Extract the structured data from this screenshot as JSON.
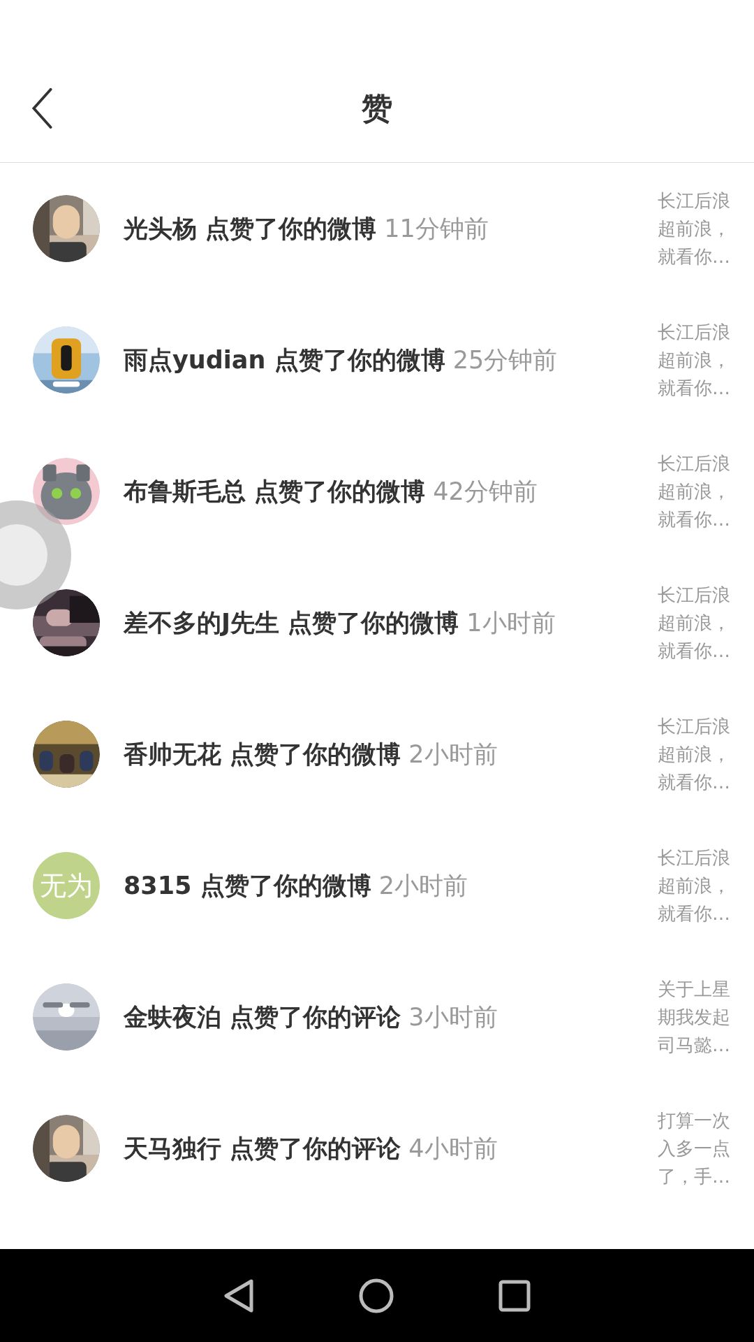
{
  "header": {
    "title": "赞"
  },
  "notifications": [
    {
      "name": "光头杨",
      "action": "点赞了你的微博",
      "time": "11分钟前",
      "preview": "长江后浪超前浪，就看你…"
    },
    {
      "name": "雨点yudian",
      "action": "点赞了你的微博",
      "time": "25分钟前",
      "preview": "长江后浪超前浪，就看你…"
    },
    {
      "name": "布鲁斯毛总",
      "action": "点赞了你的微博",
      "time": "42分钟前",
      "preview": "长江后浪超前浪，就看你…"
    },
    {
      "name": "差不多的J先生",
      "action": "点赞了你的微博",
      "time": "1小时前",
      "preview": "长江后浪超前浪，就看你…"
    },
    {
      "name": "香帅无花",
      "action": "点赞了你的微博",
      "time": "2小时前",
      "preview": "长江后浪超前浪，就看你…"
    },
    {
      "avatar": {
        "kind": "text",
        "text": "无为",
        "color": "#bfd48a"
      },
      "name": "8315",
      "action": "点赞了你的微博",
      "time": "2小时前",
      "preview": "长江后浪超前浪，就看你…"
    },
    {
      "name": "金蚨夜泊",
      "action": "点赞了你的评论",
      "time": "3小时前",
      "preview": "关于上星期我发起司马懿…"
    },
    {
      "name": "天马独行",
      "action": "点赞了你的评论",
      "time": "4小时前",
      "preview": "打算一次入多一点了，手…"
    }
  ],
  "floating_button": {
    "shown": true
  }
}
